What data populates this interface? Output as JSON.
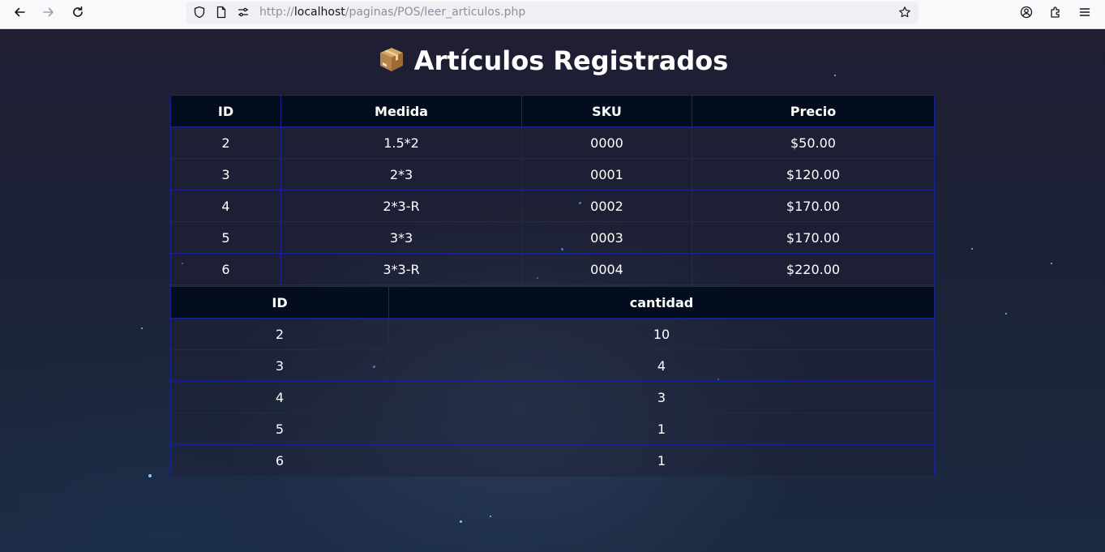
{
  "browser": {
    "url_prefix": "http://",
    "url_host": "localhost",
    "url_path": "/paginas/POS/leer_articulos.php",
    "icons": [
      "back-icon",
      "forward-icon",
      "reload-icon",
      "shield-icon",
      "page-icon",
      "permissions-icon",
      "bookmark-star-icon",
      "account-icon",
      "extensions-icon",
      "menu-icon"
    ]
  },
  "page": {
    "title": "Artículos Registrados",
    "title_icon": "package-icon"
  },
  "articulos": {
    "headers": [
      "ID",
      "Medida",
      "SKU",
      "Precio"
    ],
    "rows": [
      [
        "2",
        "1.5*2",
        "0000",
        "$50.00"
      ],
      [
        "3",
        "2*3",
        "0001",
        "$120.00"
      ],
      [
        "4",
        "2*3-R",
        "0002",
        "$170.00"
      ],
      [
        "5",
        "3*3",
        "0003",
        "$170.00"
      ],
      [
        "6",
        "3*3-R",
        "0004",
        "$220.00"
      ]
    ]
  },
  "inventario": {
    "headers": [
      "ID",
      "cantidad"
    ],
    "rows": [
      [
        "2",
        "10"
      ],
      [
        "3",
        "4"
      ],
      [
        "4",
        "3"
      ],
      [
        "5",
        "1"
      ],
      [
        "6",
        "1"
      ]
    ]
  },
  "colors": {
    "header_bg": "#030d1d",
    "border": "#17219a",
    "text": "#ffffff"
  }
}
